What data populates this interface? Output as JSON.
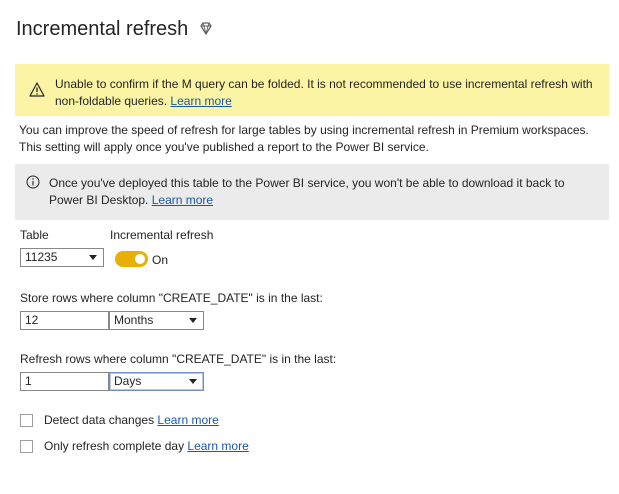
{
  "header": {
    "title": "Incremental refresh",
    "premium_icon": "diamond-icon"
  },
  "warning": {
    "icon": "warning-icon",
    "text": "Unable to confirm if the M query can be folded. It is not recommended to use incremental refresh with non-foldable queries.",
    "link": "Learn more"
  },
  "description": "You can improve the speed of refresh for large tables by using incremental refresh in Premium workspaces. This setting will apply once you've published a report to the Power BI service.",
  "info": {
    "icon": "info-icon",
    "text": "Once you've deployed this table to the Power BI service, you won't be able to download it back to Power BI Desktop.",
    "link": "Learn more"
  },
  "table": {
    "label": "Table",
    "value": "11235"
  },
  "incremental": {
    "label": "Incremental refresh",
    "state": "On"
  },
  "store": {
    "label": "Store rows where column \"CREATE_DATE\" is in the last:",
    "value": "12",
    "unit": "Months"
  },
  "refresh": {
    "label": "Refresh rows where column \"CREATE_DATE\" is in the last:",
    "value": "1",
    "unit": "Days"
  },
  "options": {
    "detect": {
      "label": "Detect data changes",
      "link": "Learn more"
    },
    "complete": {
      "label": "Only refresh complete day",
      "link": "Learn more"
    }
  },
  "colors": {
    "warning_bg": "#fbf4a5",
    "info_bg": "#ebebeb",
    "toggle_on": "#e8b005",
    "link": "#1a56a8"
  }
}
